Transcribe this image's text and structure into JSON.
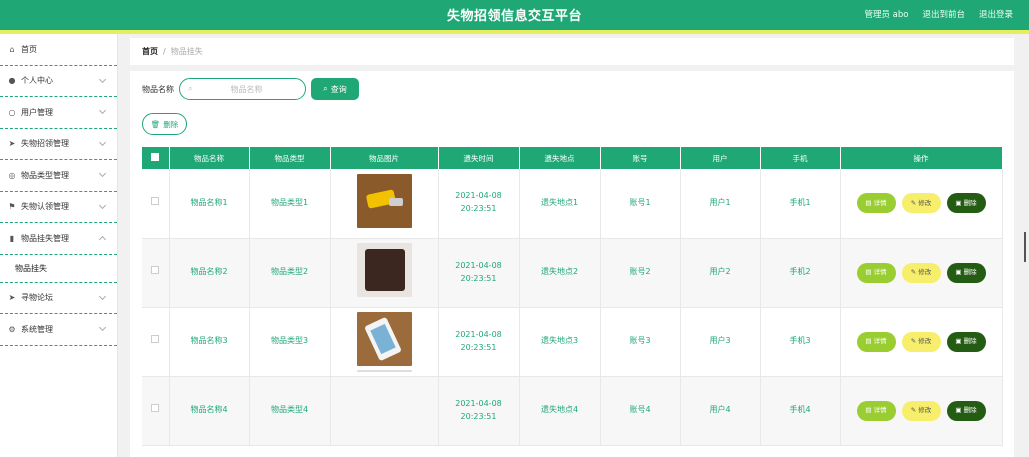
{
  "header": {
    "title": "失物招领信息交互平台",
    "user": "管理员 abo",
    "back_to_front": "退出到前台",
    "logout": "退出登录"
  },
  "sidebar": {
    "items": [
      {
        "label": "首页",
        "icon": "home-icon",
        "chevron": false
      },
      {
        "label": "个人中心",
        "icon": "user-icon",
        "chevron": true
      },
      {
        "label": "用户管理",
        "icon": "user-outline-icon",
        "chevron": true
      },
      {
        "label": "失物招领管理",
        "icon": "send-icon",
        "chevron": true
      },
      {
        "label": "物品类型管理",
        "icon": "circle-icon",
        "chevron": true
      },
      {
        "label": "失物认领管理",
        "icon": "flag-icon",
        "chevron": true
      },
      {
        "label": "物品挂失管理",
        "icon": "bar-chart-icon",
        "chevron": true,
        "open": true
      }
    ],
    "sub_item": "物品挂失",
    "after_items": [
      {
        "label": "寻物论坛",
        "icon": "send-icon",
        "chevron": true
      },
      {
        "label": "系统管理",
        "icon": "gear-icon",
        "chevron": true
      }
    ]
  },
  "breadcrumb": {
    "home": "首页",
    "separator": "/",
    "current": "物品挂失"
  },
  "search": {
    "label": "物品名称",
    "placeholder": "物品名称",
    "button": "查询"
  },
  "delete_button": "删除",
  "table": {
    "headers": [
      "物品名称",
      "物品类型",
      "物品图片",
      "遗失时间",
      "遗失地点",
      "账号",
      "用户",
      "手机",
      "操作"
    ],
    "rows": [
      {
        "name": "物品名称1",
        "type": "物品类型1",
        "image": "keys",
        "time": "2021-04-08 20:23:51",
        "place": "遗失地点1",
        "account": "账号1",
        "user": "用户1",
        "phone": "手机1"
      },
      {
        "name": "物品名称2",
        "type": "物品类型2",
        "image": "wallet",
        "time": "2021-04-08 20:23:51",
        "place": "遗失地点2",
        "account": "账号2",
        "user": "用户2",
        "phone": "手机2"
      },
      {
        "name": "物品名称3",
        "type": "物品类型3",
        "image": "phone",
        "time": "2021-04-08 20:23:51",
        "place": "遗失地点3",
        "account": "账号3",
        "user": "用户3",
        "phone": "手机3"
      },
      {
        "name": "物品名称4",
        "type": "物品类型4",
        "image": "empty",
        "time": "2021-04-08 20:23:51",
        "place": "遗失地点4",
        "account": "账号4",
        "user": "用户4",
        "phone": "手机4"
      }
    ],
    "actions": {
      "detail": "详情",
      "edit": "修改",
      "remove": "删除"
    }
  },
  "colors": {
    "primary": "#1fa876",
    "stripe": "#e5ef5c",
    "detail": "#9acd32",
    "edit": "#f7ee6b",
    "remove": "#245c14"
  }
}
